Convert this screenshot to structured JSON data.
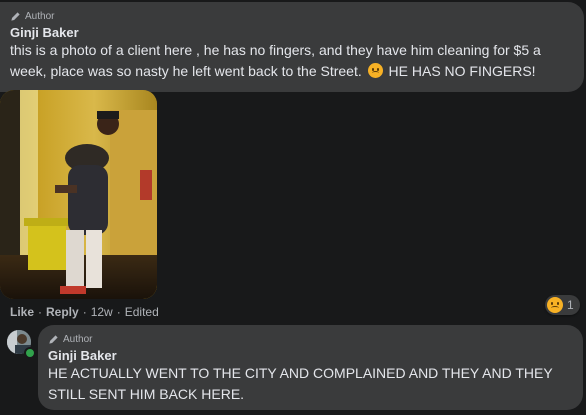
{
  "comment1": {
    "badge": "Author",
    "name": "Ginji Baker",
    "text_before_emoji": "this is a photo of a client here , he has no fingers, and they have him cleaning for $5 a week, place was so nasty he left went back to the Street.",
    "text_after_emoji": "HE HAS NO FINGERS!",
    "emoji_icon": "sad-face-emoji-icon"
  },
  "actions": {
    "like": "Like",
    "sep1": "·",
    "reply": "Reply",
    "sep2": "·",
    "time": "12w",
    "sep3": "·",
    "edited": "Edited"
  },
  "reactions": {
    "icon": "sad-reaction-icon",
    "count": "1"
  },
  "comment2": {
    "badge": "Author",
    "name": "Ginji Baker",
    "text": "HE ACTUALLY WENT TO THE CITY AND COMPLAINED AND THEY AND THEY STILL SENT HIM BACK HERE."
  },
  "colors": {
    "background": "#18191a",
    "bubble": "#3a3b3c",
    "text": "#e4e6eb",
    "secondary_text": "#b0b3b8",
    "online": "#31a24c"
  }
}
